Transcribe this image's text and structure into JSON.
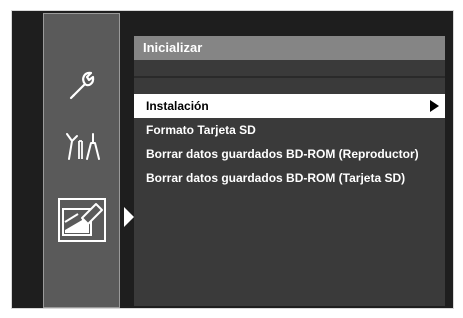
{
  "panel": {
    "title": "Inicializar"
  },
  "menu": {
    "items": [
      {
        "label": "Instalación",
        "selected": true
      },
      {
        "label": "Formato Tarjeta SD",
        "selected": false
      },
      {
        "label": "Borrar datos guardados BD-ROM (Reproductor)",
        "selected": false
      },
      {
        "label": "Borrar datos guardados BD-ROM (Tarjeta SD)",
        "selected": false
      }
    ]
  },
  "sidebar": {
    "icons": [
      "wrench-icon",
      "tools-icon",
      "erase-card-icon"
    ],
    "selected_icon": "erase-card-icon"
  },
  "colors": {
    "background": "#1e1e1e",
    "sidebar": "#5a5a5a",
    "panel": "#3a3a3a",
    "title_bar": "#858585",
    "highlight": "#ffffff"
  }
}
